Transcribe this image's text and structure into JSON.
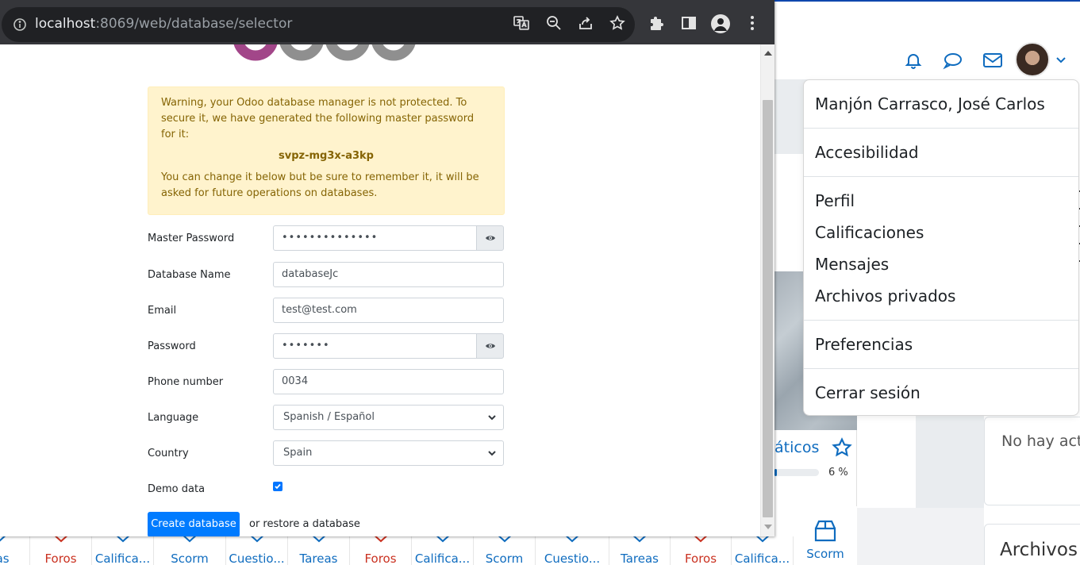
{
  "browser": {
    "url_host": "localhost",
    "url_rest": ":8069/web/database/selector"
  },
  "odoo": {
    "warning": {
      "line1": "Warning, your Odoo database manager is not protected. To secure it, we have generated the following master password for it:",
      "password": "svpz-mg3x-a3kp",
      "line2": "You can change it below but be sure to remember it, it will be asked for future operations on databases."
    },
    "fields": {
      "master_password": {
        "label": "Master Password",
        "value": "••••••••••••••"
      },
      "database_name": {
        "label": "Database Name",
        "value": "databaseJc"
      },
      "email": {
        "label": "Email",
        "value": "test@test.com"
      },
      "password": {
        "label": "Password",
        "value": "•••••••"
      },
      "phone": {
        "label": "Phone number",
        "value": "0034"
      },
      "language": {
        "label": "Language",
        "value": "Spanish / Español"
      },
      "country": {
        "label": "Country",
        "value": "Spain"
      },
      "demo_data": {
        "label": "Demo data",
        "checked": true
      }
    },
    "create_button": "Create database",
    "restore_text": "or restore a database"
  },
  "moodle": {
    "user_menu": {
      "user_name": "Manjón Carrasco, José Carlos",
      "accessibility": "Accesibilidad",
      "profile": "Perfil",
      "grades": "Calificaciones",
      "messages": "Mensajes",
      "private_files": "Archivos privados",
      "preferences": "Preferencias",
      "logout": "Cerrar sesión"
    },
    "course_title_fragment": "áticos",
    "course_progress_pct": 6,
    "course_progress_text": "6 %",
    "no_activity_text": "No hay act",
    "archivos_heading": "Archivos",
    "activity_tiles": [
      "eas",
      "Foros",
      "Califica...",
      "Scorm",
      "Cuestio...",
      "Tareas",
      "Foros",
      "Califica...",
      "Scorm",
      "Cuestio...",
      "Tareas",
      "Foros",
      "Califica...",
      "Scorm"
    ],
    "colors": {
      "accent": "#0f6cbf",
      "forum_red": "#ca3120"
    }
  }
}
